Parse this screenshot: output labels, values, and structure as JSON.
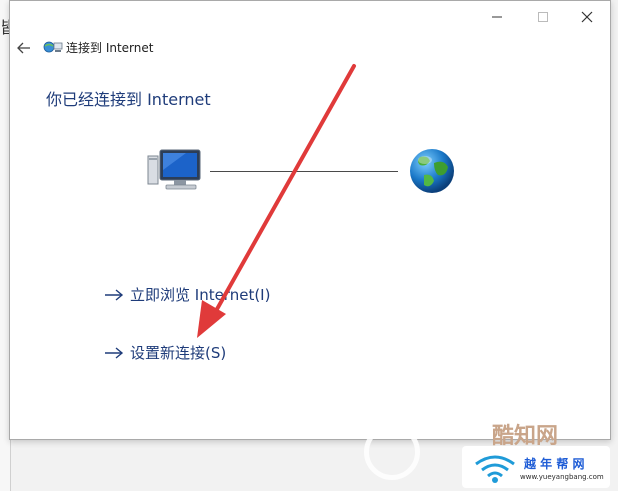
{
  "window": {
    "nav_title": "连接到 Internet",
    "heading": "你已经连接到 Internet"
  },
  "icons": {
    "back": "back-arrow-icon",
    "app": "network-connection-icon",
    "computer": "computer-icon",
    "globe": "internet-globe-icon",
    "minimize": "minimize-icon",
    "maximize": "maximize-icon",
    "close": "close-icon"
  },
  "links": [
    {
      "label": "立即浏览 Internet(I)"
    },
    {
      "label": "设置新连接(S)"
    }
  ],
  "watermark": {
    "text1": "酷知网",
    "text2": "越 年 帮 网",
    "text3": "www.yueyangbang.com"
  },
  "colors": {
    "link": "#1f3c7a",
    "annotation_arrow": "#e03a3a",
    "background": "#f2f2f2"
  }
}
